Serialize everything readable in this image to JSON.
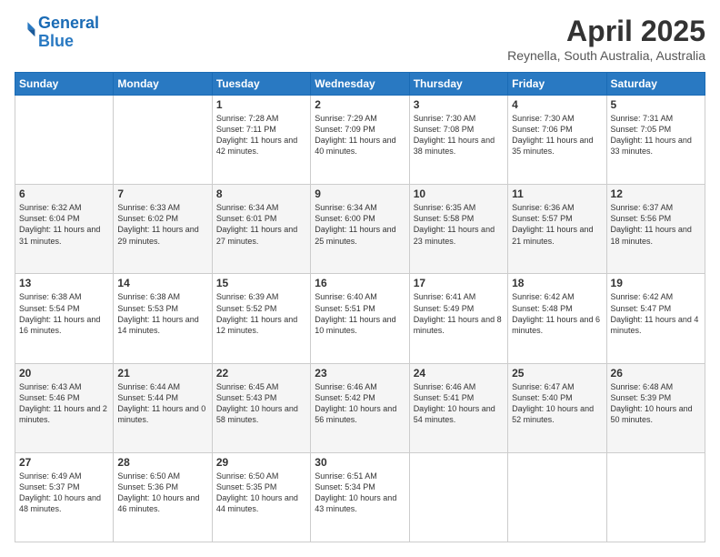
{
  "header": {
    "logo_general": "General",
    "logo_blue": "Blue",
    "month": "April 2025",
    "location": "Reynella, South Australia, Australia"
  },
  "days_of_week": [
    "Sunday",
    "Monday",
    "Tuesday",
    "Wednesday",
    "Thursday",
    "Friday",
    "Saturday"
  ],
  "weeks": [
    [
      {
        "day": "",
        "content": ""
      },
      {
        "day": "",
        "content": ""
      },
      {
        "day": "1",
        "content": "Sunrise: 7:28 AM\nSunset: 7:11 PM\nDaylight: 11 hours and 42 minutes."
      },
      {
        "day": "2",
        "content": "Sunrise: 7:29 AM\nSunset: 7:09 PM\nDaylight: 11 hours and 40 minutes."
      },
      {
        "day": "3",
        "content": "Sunrise: 7:30 AM\nSunset: 7:08 PM\nDaylight: 11 hours and 38 minutes."
      },
      {
        "day": "4",
        "content": "Sunrise: 7:30 AM\nSunset: 7:06 PM\nDaylight: 11 hours and 35 minutes."
      },
      {
        "day": "5",
        "content": "Sunrise: 7:31 AM\nSunset: 7:05 PM\nDaylight: 11 hours and 33 minutes."
      }
    ],
    [
      {
        "day": "6",
        "content": "Sunrise: 6:32 AM\nSunset: 6:04 PM\nDaylight: 11 hours and 31 minutes."
      },
      {
        "day": "7",
        "content": "Sunrise: 6:33 AM\nSunset: 6:02 PM\nDaylight: 11 hours and 29 minutes."
      },
      {
        "day": "8",
        "content": "Sunrise: 6:34 AM\nSunset: 6:01 PM\nDaylight: 11 hours and 27 minutes."
      },
      {
        "day": "9",
        "content": "Sunrise: 6:34 AM\nSunset: 6:00 PM\nDaylight: 11 hours and 25 minutes."
      },
      {
        "day": "10",
        "content": "Sunrise: 6:35 AM\nSunset: 5:58 PM\nDaylight: 11 hours and 23 minutes."
      },
      {
        "day": "11",
        "content": "Sunrise: 6:36 AM\nSunset: 5:57 PM\nDaylight: 11 hours and 21 minutes."
      },
      {
        "day": "12",
        "content": "Sunrise: 6:37 AM\nSunset: 5:56 PM\nDaylight: 11 hours and 18 minutes."
      }
    ],
    [
      {
        "day": "13",
        "content": "Sunrise: 6:38 AM\nSunset: 5:54 PM\nDaylight: 11 hours and 16 minutes."
      },
      {
        "day": "14",
        "content": "Sunrise: 6:38 AM\nSunset: 5:53 PM\nDaylight: 11 hours and 14 minutes."
      },
      {
        "day": "15",
        "content": "Sunrise: 6:39 AM\nSunset: 5:52 PM\nDaylight: 11 hours and 12 minutes."
      },
      {
        "day": "16",
        "content": "Sunrise: 6:40 AM\nSunset: 5:51 PM\nDaylight: 11 hours and 10 minutes."
      },
      {
        "day": "17",
        "content": "Sunrise: 6:41 AM\nSunset: 5:49 PM\nDaylight: 11 hours and 8 minutes."
      },
      {
        "day": "18",
        "content": "Sunrise: 6:42 AM\nSunset: 5:48 PM\nDaylight: 11 hours and 6 minutes."
      },
      {
        "day": "19",
        "content": "Sunrise: 6:42 AM\nSunset: 5:47 PM\nDaylight: 11 hours and 4 minutes."
      }
    ],
    [
      {
        "day": "20",
        "content": "Sunrise: 6:43 AM\nSunset: 5:46 PM\nDaylight: 11 hours and 2 minutes."
      },
      {
        "day": "21",
        "content": "Sunrise: 6:44 AM\nSunset: 5:44 PM\nDaylight: 11 hours and 0 minutes."
      },
      {
        "day": "22",
        "content": "Sunrise: 6:45 AM\nSunset: 5:43 PM\nDaylight: 10 hours and 58 minutes."
      },
      {
        "day": "23",
        "content": "Sunrise: 6:46 AM\nSunset: 5:42 PM\nDaylight: 10 hours and 56 minutes."
      },
      {
        "day": "24",
        "content": "Sunrise: 6:46 AM\nSunset: 5:41 PM\nDaylight: 10 hours and 54 minutes."
      },
      {
        "day": "25",
        "content": "Sunrise: 6:47 AM\nSunset: 5:40 PM\nDaylight: 10 hours and 52 minutes."
      },
      {
        "day": "26",
        "content": "Sunrise: 6:48 AM\nSunset: 5:39 PM\nDaylight: 10 hours and 50 minutes."
      }
    ],
    [
      {
        "day": "27",
        "content": "Sunrise: 6:49 AM\nSunset: 5:37 PM\nDaylight: 10 hours and 48 minutes."
      },
      {
        "day": "28",
        "content": "Sunrise: 6:50 AM\nSunset: 5:36 PM\nDaylight: 10 hours and 46 minutes."
      },
      {
        "day": "29",
        "content": "Sunrise: 6:50 AM\nSunset: 5:35 PM\nDaylight: 10 hours and 44 minutes."
      },
      {
        "day": "30",
        "content": "Sunrise: 6:51 AM\nSunset: 5:34 PM\nDaylight: 10 hours and 43 minutes."
      },
      {
        "day": "",
        "content": ""
      },
      {
        "day": "",
        "content": ""
      },
      {
        "day": "",
        "content": ""
      }
    ]
  ]
}
